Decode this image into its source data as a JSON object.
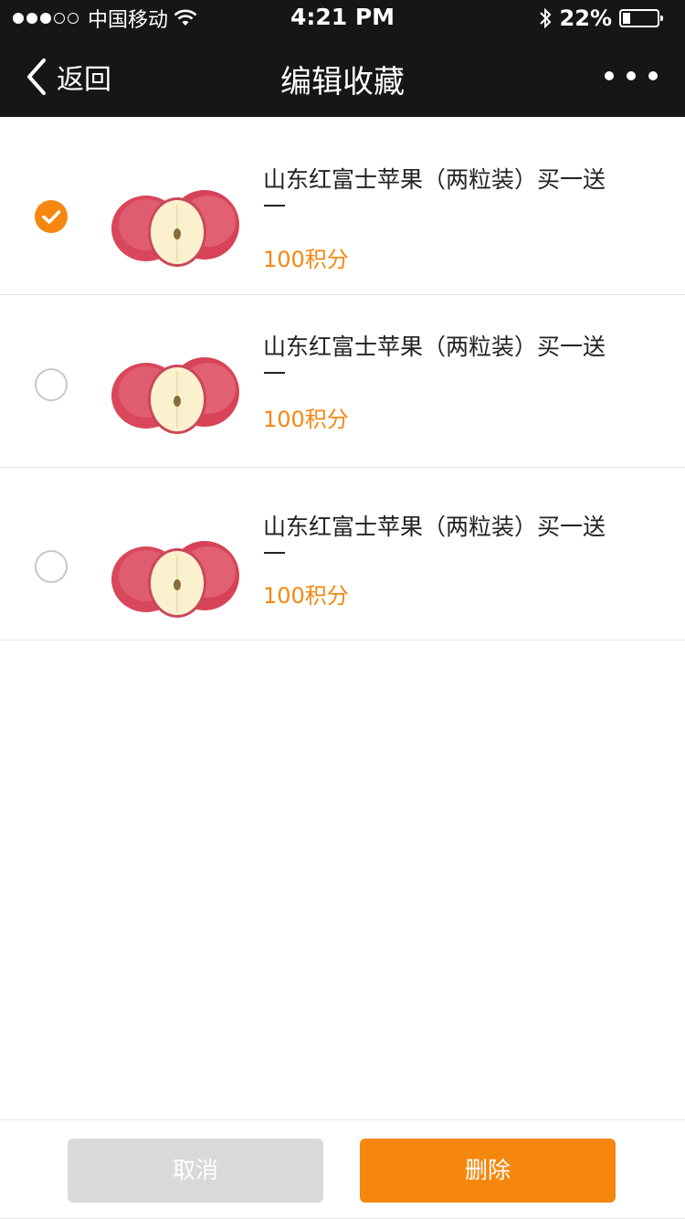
{
  "status_bar": {
    "carrier": "中国移动",
    "time": "4:21 PM",
    "battery_percent": "22%",
    "signal_bars_filled": 3,
    "signal_bars_total": 5,
    "battery_level": 0.22
  },
  "nav": {
    "back_label": "返回",
    "title": "编辑收藏"
  },
  "items": [
    {
      "title": "山东红富士苹果（两粒装）买一送一",
      "points": "100积分",
      "selected": true
    },
    {
      "title": "山东红富士苹果（两粒装）买一送一",
      "points": "100积分",
      "selected": false
    },
    {
      "title": "山东红富士苹果（两粒装）买一送一",
      "points": "100积分",
      "selected": false
    }
  ],
  "footer": {
    "cancel_label": "取消",
    "delete_label": "删除"
  },
  "colors": {
    "accent": "#f5870f",
    "nav_background": "#161616",
    "cancel_button": "#d9d9d9"
  },
  "icons": {
    "back": "chevron-left-icon",
    "more": "more-dots-icon",
    "wifi": "wifi-icon",
    "bluetooth": "bluetooth-icon",
    "battery": "battery-icon",
    "check": "checkmark-icon"
  }
}
